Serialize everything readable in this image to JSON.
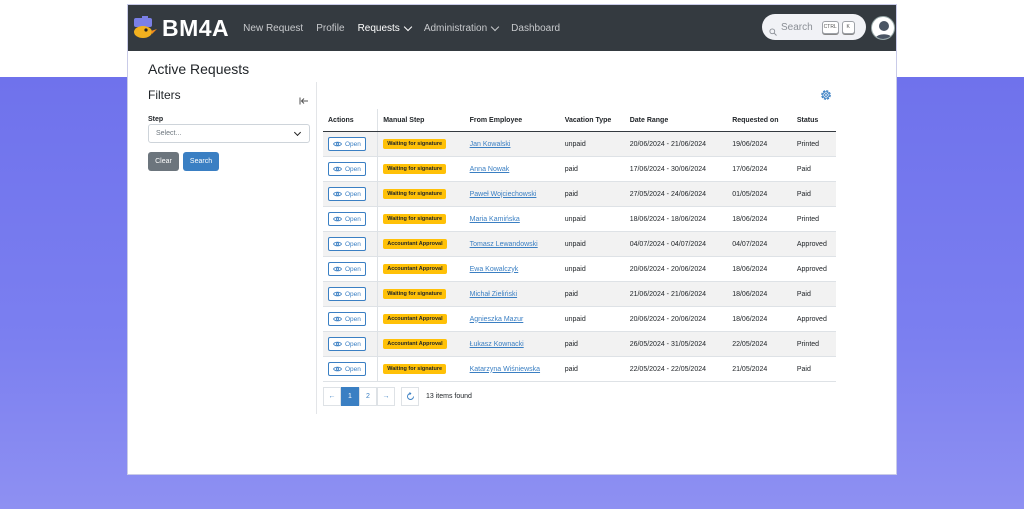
{
  "app": {
    "brand": "BM4A",
    "nav": [
      {
        "label": "New Request",
        "active": false,
        "dropdown": false
      },
      {
        "label": "Profile",
        "active": false,
        "dropdown": false
      },
      {
        "label": "Requests",
        "active": true,
        "dropdown": true
      },
      {
        "label": "Administration",
        "active": false,
        "dropdown": true
      },
      {
        "label": "Dashboard",
        "active": false,
        "dropdown": false
      }
    ],
    "search": {
      "label": "Search",
      "shortcut_ctrl": "CTRL",
      "shortcut_key": "K"
    }
  },
  "page": {
    "title": "Active Requests"
  },
  "filters": {
    "title": "Filters",
    "step_label": "Step",
    "step_placeholder": "Select...",
    "clear_label": "Clear",
    "search_label": "Search"
  },
  "table": {
    "columns": [
      "Actions",
      "Manual Step",
      "From Employee",
      "Vacation Type",
      "Date Range",
      "Requested on",
      "Status"
    ],
    "open_label": "Open",
    "rows": [
      {
        "step": "Waiting for signature",
        "employee": "Jan Kowalski",
        "type": "unpaid",
        "range": "20/06/2024 - 21/06/2024",
        "requested": "19/06/2024",
        "status": "Printed"
      },
      {
        "step": "Waiting for signature",
        "employee": "Anna Nowak",
        "type": "paid",
        "range": "17/06/2024 - 30/06/2024",
        "requested": "17/06/2024",
        "status": "Paid"
      },
      {
        "step": "Waiting for signature",
        "employee": "Paweł Wojciechowski",
        "type": "paid",
        "range": "27/05/2024 - 24/06/2024",
        "requested": "01/05/2024",
        "status": "Paid"
      },
      {
        "step": "Waiting for signature",
        "employee": "Maria Kamińska",
        "type": "unpaid",
        "range": "18/06/2024 - 18/06/2024",
        "requested": "18/06/2024",
        "status": "Printed"
      },
      {
        "step": "Accountant Approval",
        "employee": "Tomasz Lewandowski",
        "type": "unpaid",
        "range": "04/07/2024 - 04/07/2024",
        "requested": "04/07/2024",
        "status": "Approved"
      },
      {
        "step": "Accountant Approval",
        "employee": "Ewa Kowalczyk",
        "type": "unpaid",
        "range": "20/06/2024 - 20/06/2024",
        "requested": "18/06/2024",
        "status": "Approved"
      },
      {
        "step": "Waiting for signature",
        "employee": "Michał Zieliński",
        "type": "paid",
        "range": "21/06/2024 - 21/06/2024",
        "requested": "18/06/2024",
        "status": "Paid"
      },
      {
        "step": "Accountant Approval",
        "employee": "Agnieszka Mazur",
        "type": "unpaid",
        "range": "20/06/2024 - 20/06/2024",
        "requested": "18/06/2024",
        "status": "Approved"
      },
      {
        "step": "Accountant Approval",
        "employee": "Łukasz Kownacki",
        "type": "paid",
        "range": "26/05/2024 - 31/05/2024",
        "requested": "22/05/2024",
        "status": "Printed"
      },
      {
        "step": "Waiting for signature",
        "employee": "Katarzyna Wiśniewska",
        "type": "paid",
        "range": "22/05/2024 - 22/05/2024",
        "requested": "21/05/2024",
        "status": "Paid"
      }
    ]
  },
  "pagination": {
    "prev": "←",
    "pages": [
      "1",
      "2"
    ],
    "current_page": "1",
    "next": "→",
    "items_found": "13 items found"
  },
  "colors": {
    "navbar": "#343a40",
    "accent": "#3a7fc3",
    "badge": "#ffc107",
    "background_gradient": "#6f72ec"
  }
}
